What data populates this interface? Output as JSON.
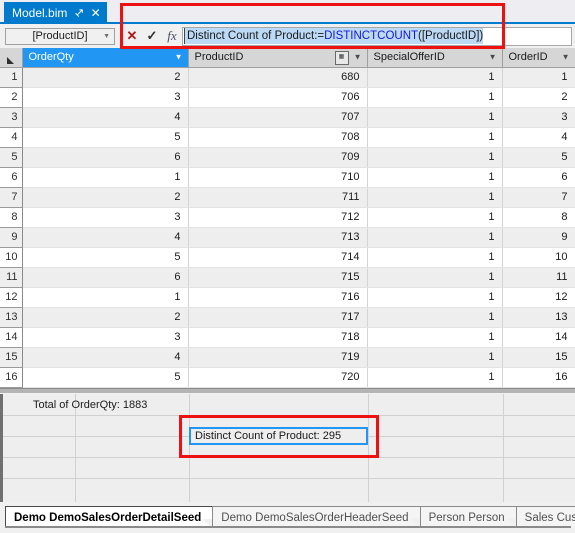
{
  "window": {
    "document_tab": {
      "title": "Model.bim",
      "pin_icon": "pin-icon",
      "close_icon": "close-icon",
      "pin_glyph": "↥",
      "close_glyph": "✕"
    }
  },
  "formula_bar": {
    "name_box_value": "[ProductID]",
    "cancel_glyph": "✕",
    "accept_glyph": "✓",
    "fx_label": "fx",
    "formula_prefix": "Distinct Count of Product:=",
    "formula_function": "DISTINCTCOUNT",
    "formula_suffix": "([ProductID])",
    "formula_full": "Distinct Count of Product:=DISTINCTCOUNT([ProductID])"
  },
  "grid": {
    "columns": [
      {
        "label": "OrderQty",
        "selected": true,
        "has_calc_icon": false
      },
      {
        "label": "ProductID",
        "selected": false,
        "has_calc_icon": true
      },
      {
        "label": "SpecialOfferID",
        "selected": false,
        "has_calc_icon": false
      },
      {
        "label": "OrderID",
        "selected": false,
        "has_calc_icon": false
      }
    ],
    "rows": [
      {
        "n": "1",
        "OrderQty": "2",
        "ProductID": "680",
        "SpecialOfferID": "1",
        "OrderID": "1"
      },
      {
        "n": "2",
        "OrderQty": "3",
        "ProductID": "706",
        "SpecialOfferID": "1",
        "OrderID": "2"
      },
      {
        "n": "3",
        "OrderQty": "4",
        "ProductID": "707",
        "SpecialOfferID": "1",
        "OrderID": "3"
      },
      {
        "n": "4",
        "OrderQty": "5",
        "ProductID": "708",
        "SpecialOfferID": "1",
        "OrderID": "4"
      },
      {
        "n": "5",
        "OrderQty": "6",
        "ProductID": "709",
        "SpecialOfferID": "1",
        "OrderID": "5"
      },
      {
        "n": "6",
        "OrderQty": "1",
        "ProductID": "710",
        "SpecialOfferID": "1",
        "OrderID": "6"
      },
      {
        "n": "7",
        "OrderQty": "2",
        "ProductID": "711",
        "SpecialOfferID": "1",
        "OrderID": "7"
      },
      {
        "n": "8",
        "OrderQty": "3",
        "ProductID": "712",
        "SpecialOfferID": "1",
        "OrderID": "8"
      },
      {
        "n": "9",
        "OrderQty": "4",
        "ProductID": "713",
        "SpecialOfferID": "1",
        "OrderID": "9"
      },
      {
        "n": "10",
        "OrderQty": "5",
        "ProductID": "714",
        "SpecialOfferID": "1",
        "OrderID": "10"
      },
      {
        "n": "11",
        "OrderQty": "6",
        "ProductID": "715",
        "SpecialOfferID": "1",
        "OrderID": "11"
      },
      {
        "n": "12",
        "OrderQty": "1",
        "ProductID": "716",
        "SpecialOfferID": "1",
        "OrderID": "12"
      },
      {
        "n": "13",
        "OrderQty": "2",
        "ProductID": "717",
        "SpecialOfferID": "1",
        "OrderID": "13"
      },
      {
        "n": "14",
        "OrderQty": "3",
        "ProductID": "718",
        "SpecialOfferID": "1",
        "OrderID": "14"
      },
      {
        "n": "15",
        "OrderQty": "4",
        "ProductID": "719",
        "SpecialOfferID": "1",
        "OrderID": "15"
      },
      {
        "n": "16",
        "OrderQty": "5",
        "ProductID": "720",
        "SpecialOfferID": "1",
        "OrderID": "16"
      }
    ]
  },
  "measure_grid": {
    "total_measure": "Total of OrderQty: 1883",
    "selected_measure": "Distinct Count of Product: 295"
  },
  "sheet_tabs": [
    {
      "label": "Demo DemoSalesOrderDetailSeed",
      "active": true
    },
    {
      "label": "Demo DemoSalesOrderHeaderSeed",
      "active": false
    },
    {
      "label": "Person Person",
      "active": false
    },
    {
      "label": "Sales Cust",
      "active": false
    }
  ],
  "colors": {
    "accent": "#007acc",
    "selection": "#2196f3",
    "annotation": "#ee1111",
    "function_keyword": "#1818d0"
  }
}
